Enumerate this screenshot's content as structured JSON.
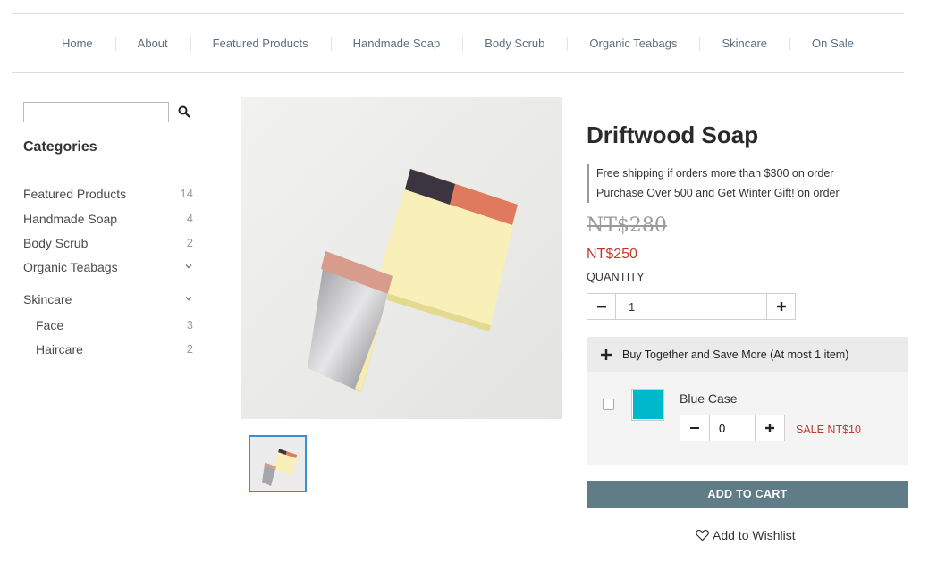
{
  "nav": {
    "items": [
      "Home",
      "About",
      "Featured Products",
      "Handmade Soap",
      "Body Scrub",
      "Organic Teabags",
      "Skincare",
      "On Sale"
    ]
  },
  "sidebar": {
    "search_value": "",
    "categories_title": "Categories",
    "categories": [
      {
        "label": "Featured Products",
        "count": "14"
      },
      {
        "label": "Handmade Soap",
        "count": "4"
      },
      {
        "label": "Body Scrub",
        "count": "2"
      },
      {
        "label": "Organic Teabags",
        "count": ""
      },
      {
        "label": "Skincare",
        "count": ""
      },
      {
        "label": "Face",
        "count": "3"
      },
      {
        "label": "Haircare",
        "count": "2"
      }
    ]
  },
  "product": {
    "title": "Driftwood Soap",
    "promos": [
      "Free shipping if orders more than $300 on order",
      "Purchase Over 500 and Get Winter Gift! on order"
    ],
    "old_price": "NT$280",
    "price": "NT$250",
    "quantity_label": "QUANTITY",
    "quantity_value": "1"
  },
  "bundle": {
    "header": "Buy Together and Save More (At most 1 item)",
    "item_name": "Blue Case",
    "item_qty": "0",
    "sale_text": "SALE NT$10",
    "swatch_color": "#00b8cc"
  },
  "actions": {
    "add_to_cart": "ADD TO CART",
    "wishlist": "Add to Wishlist"
  },
  "colors": {
    "accent_button": "#5f7c87",
    "sale_red": "#c0392b",
    "thumb_border": "#3a8fcf"
  }
}
